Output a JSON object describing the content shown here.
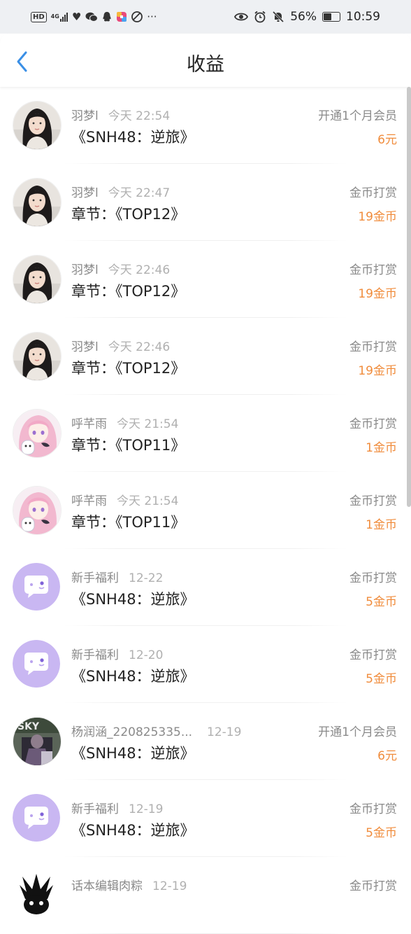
{
  "status_bar": {
    "hd_label": "HD",
    "network_label": "4G",
    "battery_percent": 56,
    "battery_text": "56%",
    "time": "10:59",
    "left_icons": [
      "heart-rate-icon",
      "wechat-icon",
      "qq-icon",
      "app-icon",
      "browser-icon",
      "more-icon"
    ],
    "right_icons": [
      "eye-icon",
      "alarm-icon",
      "mute-icon",
      "battery-icon"
    ]
  },
  "header": {
    "title": "收益"
  },
  "colors": {
    "accent_blue": "#3a8fe6",
    "amount_orange": "#f08c3c",
    "avatar_purple": "#c9b7f2"
  },
  "rows": [
    {
      "user": "羽梦l",
      "time": "今天 22:54",
      "book": "《SNH48：逆旅》",
      "type": "开通1个月会员",
      "amount": "6元",
      "avatar": "photo-woman"
    },
    {
      "user": "羽梦l",
      "time": "今天 22:47",
      "book": "章节：《TOP12》",
      "type": "金币打赏",
      "amount": "19金币",
      "avatar": "photo-woman"
    },
    {
      "user": "羽梦l",
      "time": "今天 22:46",
      "book": "章节：《TOP12》",
      "type": "金币打赏",
      "amount": "19金币",
      "avatar": "photo-woman"
    },
    {
      "user": "羽梦l",
      "time": "今天 22:46",
      "book": "章节：《TOP12》",
      "type": "金币打赏",
      "amount": "19金币",
      "avatar": "photo-woman"
    },
    {
      "user": "呼芊雨",
      "time": "今天 21:54",
      "book": "章节：《TOP11》",
      "type": "金币打赏",
      "amount": "1金币",
      "avatar": "anime-girl"
    },
    {
      "user": "呼芊雨",
      "time": "今天 21:54",
      "book": "章节：《TOP11》",
      "type": "金币打赏",
      "amount": "1金币",
      "avatar": "anime-girl"
    },
    {
      "user": "新手福利",
      "time": "12-22",
      "book": "《SNH48：逆旅》",
      "type": "金币打赏",
      "amount": "5金币",
      "avatar": "chat-bubble"
    },
    {
      "user": "新手福利",
      "time": "12-20",
      "book": "《SNH48：逆旅》",
      "type": "金币打赏",
      "amount": "5金币",
      "avatar": "chat-bubble"
    },
    {
      "user": "杨润涵_220825335...",
      "time": "12-19",
      "book": "《SNH48：逆旅》",
      "type": "开通1个月会员",
      "amount": "6元",
      "avatar": "photo-dark"
    },
    {
      "user": "新手福利",
      "time": "12-19",
      "book": "《SNH48：逆旅》",
      "type": "金币打赏",
      "amount": "5金币",
      "avatar": "chat-bubble"
    },
    {
      "user": "话本编辑肉粽",
      "time": "12-19",
      "book": "",
      "type": "金币打赏",
      "amount": "",
      "avatar": "cartoon-bw"
    }
  ]
}
